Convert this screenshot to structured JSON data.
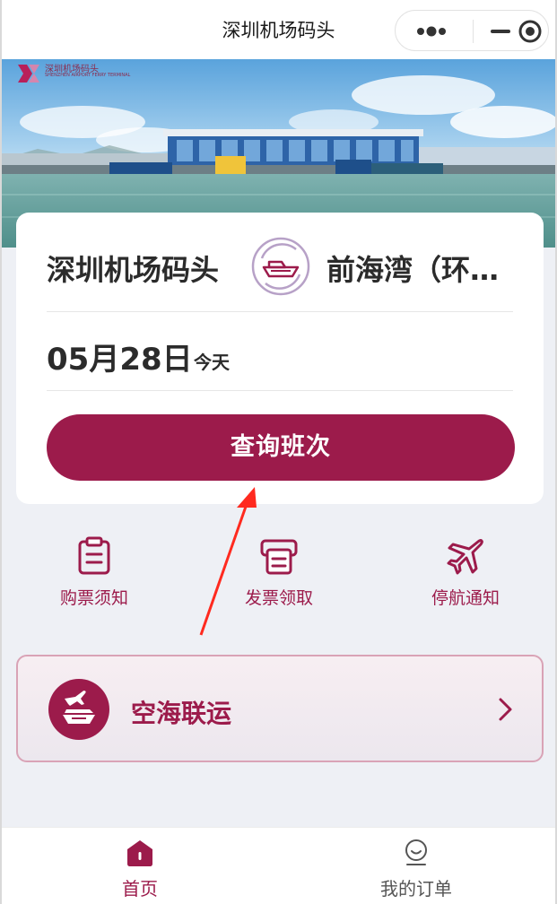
{
  "window": {
    "title": "深圳机场码头"
  },
  "brand": {
    "name_cn": "深圳机场码头",
    "name_en": "SHENZHEN AIRPORT FERRY TERMINAL"
  },
  "search": {
    "from": "深圳机场码头",
    "to": "前海湾（环…",
    "date": "05月28日",
    "date_hint": "今天",
    "query_label": "查询班次"
  },
  "quick_actions": [
    {
      "label": "购票须知",
      "icon": "clipboard-icon"
    },
    {
      "label": "发票领取",
      "icon": "printer-icon"
    },
    {
      "label": "停航通知",
      "icon": "airplane-icon"
    }
  ],
  "air_sea": {
    "label": "空海联运",
    "icon": "plane-ship-icon"
  },
  "tabs": [
    {
      "label": "首页",
      "icon": "home-icon",
      "active": true
    },
    {
      "label": "我的订单",
      "icon": "user-icon",
      "active": false
    }
  ],
  "colors": {
    "brand": "#9c1b4b",
    "annotation_arrow": "#ff2a1f"
  }
}
